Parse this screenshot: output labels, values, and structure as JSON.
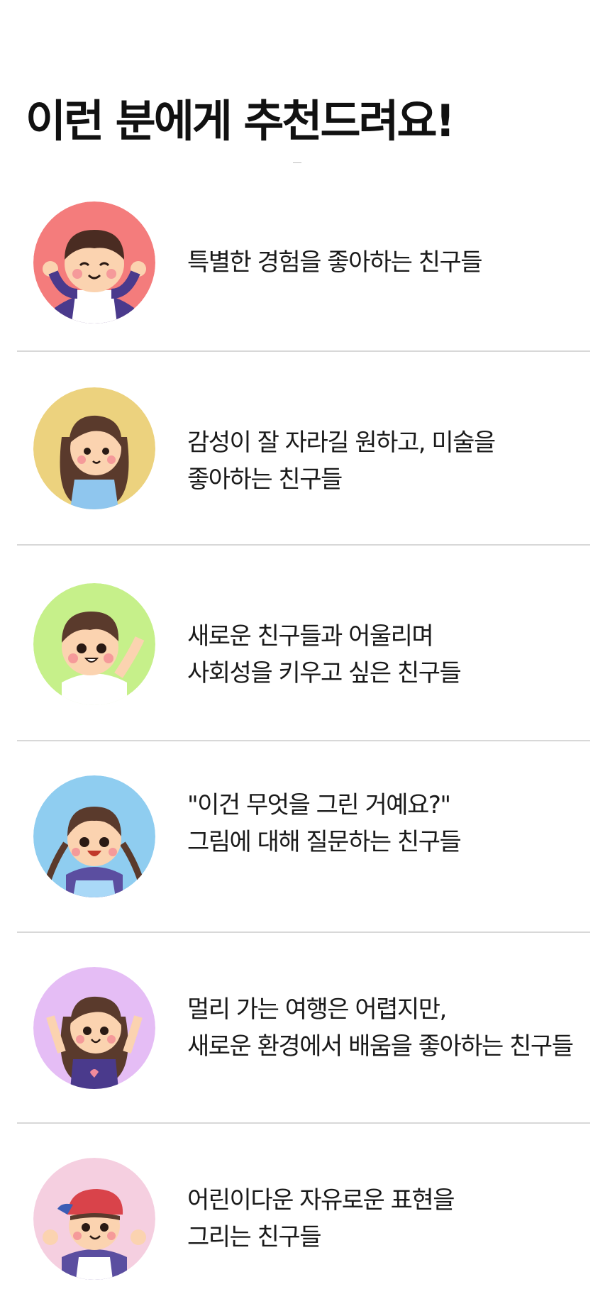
{
  "heading": "이런 분에게 추천드려요!",
  "items": [
    {
      "lines": [
        "특별한 경험을 좋아하는 친구들"
      ],
      "avatar_bg": "#f47c7c",
      "avatar": "smiling-boy-waving-icon"
    },
    {
      "lines": [
        "감성이 잘 자라길 원하고, 미술을",
        "좋아하는 친구들"
      ],
      "avatar_bg": "#ecd27e",
      "avatar": "girl-long-hair-icon"
    },
    {
      "lines": [
        "새로운 친구들과 어울리며",
        "사회성을 키우고 싶은 친구들"
      ],
      "avatar_bg": "#c6f08a",
      "avatar": "boy-waving-icon"
    },
    {
      "lines": [
        "\"이건 무엇을 그린 거예요?\"",
        "그림에 대해 질문하는 친구들"
      ],
      "avatar_bg": "#8fcdf0",
      "avatar": "girl-braids-icon"
    },
    {
      "lines": [
        "멀리 가는 여행은 어렵지만,",
        "새로운 환경에서 배움을 좋아하는 친구들"
      ],
      "avatar_bg": "#e5bdf5",
      "avatar": "girl-heart-shirt-icon"
    },
    {
      "lines": [
        "어린이다운 자유로운 표현을",
        "그리는 친구들"
      ],
      "avatar_bg": "#f5cfe0",
      "avatar": "boy-red-cap-icon"
    }
  ]
}
